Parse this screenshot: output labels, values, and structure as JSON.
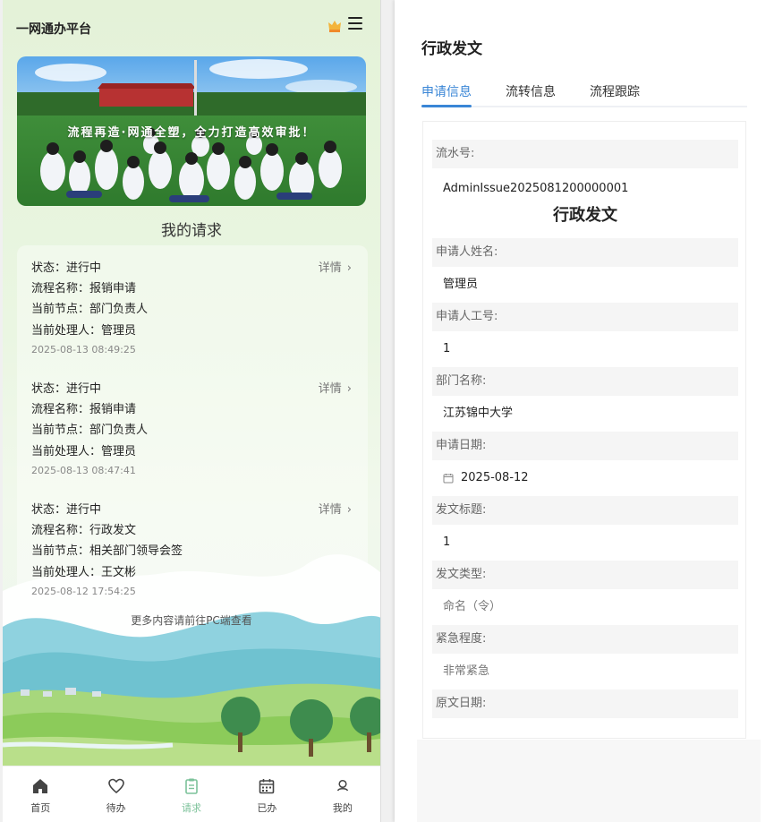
{
  "app": {
    "title": "一网通办平台"
  },
  "banner": {
    "caption": "流程再造·网通全塑，全力打造高效审批！"
  },
  "requests": {
    "section_title": "我的请求",
    "detail_label": "详情",
    "items": [
      {
        "status": "状态：进行中",
        "process": "流程名称：报销申请",
        "node": "当前节点：部门负责人",
        "handler": "当前处理人：管理员",
        "time": "2025-08-13 08:49:25"
      },
      {
        "status": "状态：进行中",
        "process": "流程名称：报销申请",
        "node": "当前节点：部门负责人",
        "handler": "当前处理人：管理员",
        "time": "2025-08-13 08:47:41"
      },
      {
        "status": "状态：进行中",
        "process": "流程名称：行政发文",
        "node": "当前节点：相关部门领导会签",
        "handler": "当前处理人：王文彬",
        "time": "2025-08-12 17:54:25"
      }
    ],
    "more_tip": "更多内容请前往PC端查看"
  },
  "tabbar": [
    {
      "label": "首页",
      "icon": "home-icon"
    },
    {
      "label": "待办",
      "icon": "heart-icon"
    },
    {
      "label": "请求",
      "icon": "clipboard-icon",
      "active": true
    },
    {
      "label": "已办",
      "icon": "calendar-icon"
    },
    {
      "label": "我的",
      "icon": "user-icon"
    }
  ],
  "detail": {
    "title": "行政发文",
    "tabs": [
      "申请信息",
      "流转信息",
      "流程跟踪"
    ],
    "form": {
      "serial_label": "流水号:",
      "serial_value": "AdminIssue2025081200000001",
      "heading": "行政发文",
      "fields": [
        {
          "label": "申请人姓名:",
          "value": "管理员"
        },
        {
          "label": "申请人工号:",
          "value": "1"
        },
        {
          "label": "部门名称:",
          "value": "江苏锦中大学"
        },
        {
          "label": "申请日期:",
          "value": "2025-08-12"
        },
        {
          "label": "发文标题:",
          "value": "1"
        },
        {
          "label": "发文类型:",
          "value": "命名（令）"
        },
        {
          "label": "紧急程度:",
          "value": "非常紧急"
        },
        {
          "label": "原文日期:",
          "value": ""
        }
      ]
    }
  },
  "colors": {
    "accent": "#3a86d6",
    "tab_active": "#7cc29a"
  }
}
